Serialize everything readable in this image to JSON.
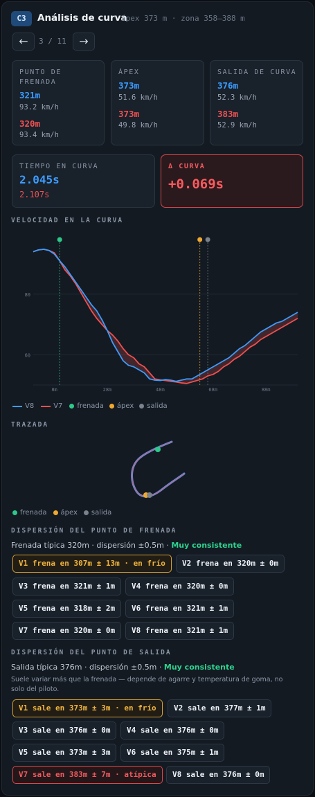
{
  "header": {
    "badge": "C3",
    "title": "Análisis de curva",
    "subtitle": "ápex 373 m · zona 358–388 m",
    "prev_label": "←",
    "next_label": "→",
    "counter": "3 / 11"
  },
  "cards": {
    "braking": {
      "label": "PUNTO DE FRENADA",
      "a_value": "321m",
      "a_speed": "93.2 km/h",
      "b_value": "320m",
      "b_speed": "93.4 km/h"
    },
    "apex": {
      "label": "ÁPEX",
      "a_value": "373m",
      "a_speed": "51.6 km/h",
      "b_value": "373m",
      "b_speed": "49.8 km/h"
    },
    "exit": {
      "label": "SALIDA DE CURVA",
      "a_value": "376m",
      "a_speed": "52.3 km/h",
      "b_value": "383m",
      "b_speed": "52.9 km/h"
    },
    "time": {
      "label": "TIEMPO EN CURVA",
      "a_value": "2.045s",
      "b_value": "2.107s"
    },
    "delta": {
      "label": "Δ CURVA",
      "value": "+0.069s"
    }
  },
  "speed_section": {
    "title": "VELOCIDAD EN LA CURVA"
  },
  "chart_data": {
    "type": "line",
    "x_ticks": [
      "8m",
      "28m",
      "48m",
      "68m",
      "88m"
    ],
    "y_ticks": [
      "80",
      "60"
    ],
    "xlim": [
      0,
      100
    ],
    "ylim": [
      50,
      98
    ],
    "markers": [
      {
        "name": "frenada",
        "x": 10,
        "color": "#2ec98a"
      },
      {
        "name": "ápex",
        "x": 63,
        "color": "#f0a830"
      },
      {
        "name": "salida",
        "x": 66,
        "color": "#7a828e"
      }
    ],
    "series": [
      {
        "name": "V8",
        "color": "#3b9cff",
        "x": [
          0,
          2,
          4,
          6,
          8,
          10,
          12,
          14,
          16,
          18,
          20,
          22,
          24,
          26,
          28,
          30,
          32,
          34,
          36,
          38,
          40,
          42,
          44,
          46,
          48,
          50,
          52,
          54,
          56,
          58,
          60,
          62,
          64,
          66,
          68,
          70,
          72,
          74,
          76,
          78,
          80,
          82,
          84,
          86,
          88,
          90,
          92,
          94,
          96,
          98,
          100
        ],
        "y": [
          94,
          94.6,
          94.8,
          94.4,
          93.2,
          91,
          89,
          86.5,
          84,
          81.5,
          79,
          76.5,
          74.5,
          71.5,
          68,
          64,
          61,
          58,
          56.5,
          56,
          55,
          54,
          52,
          51.6,
          51.5,
          51.8,
          51.6,
          51.2,
          51.6,
          52,
          52,
          53,
          54,
          55,
          56,
          57,
          58,
          59,
          60.5,
          62,
          63,
          64.5,
          66,
          67.5,
          68.5,
          69.5,
          70.5,
          71,
          72,
          73,
          74
        ]
      },
      {
        "name": "V7",
        "color": "#ef5050",
        "x": [
          0,
          2,
          4,
          6,
          8,
          10,
          12,
          14,
          16,
          18,
          20,
          22,
          24,
          26,
          28,
          30,
          32,
          34,
          36,
          38,
          40,
          42,
          44,
          46,
          48,
          50,
          52,
          54,
          56,
          58,
          60,
          62,
          64,
          66,
          68,
          70,
          72,
          74,
          76,
          78,
          80,
          82,
          84,
          86,
          88,
          90,
          92,
          94,
          96,
          98,
          100
        ],
        "y": [
          94,
          94.6,
          94.8,
          94.4,
          93.6,
          91,
          88,
          86,
          83.5,
          80.5,
          77.5,
          74.5,
          72,
          70,
          68,
          66.5,
          64.5,
          62,
          60,
          59,
          57,
          56,
          54,
          52,
          51.7,
          51.5,
          51.2,
          51,
          50.7,
          50.5,
          51,
          51.5,
          52,
          53,
          53.5,
          54.5,
          56,
          57,
          58.5,
          59.5,
          61,
          62.5,
          63.5,
          65,
          66,
          67,
          68,
          69,
          70,
          71,
          72
        ]
      }
    ]
  },
  "trace_section": {
    "title": "TRAZADA",
    "legend": [
      "frenada",
      "ápex",
      "salida"
    ]
  },
  "braking_dispersion": {
    "title": "DISPERSIÓN DEL PUNTO DE FRENADA",
    "summary_prefix": "Frenada típica 320m · dispersión ±0.5m · ",
    "summary_status": "Muy consistente",
    "chips": [
      {
        "text": "V1 frena en 307m ± 13m · en frío",
        "kind": "warn"
      },
      {
        "text": "V2 frena en 320m ± 0m",
        "kind": "normal"
      },
      {
        "text": "V3 frena en 321m ± 1m",
        "kind": "normal"
      },
      {
        "text": "V4 frena en 320m ± 0m",
        "kind": "normal"
      },
      {
        "text": "V5 frena en 318m ± 2m",
        "kind": "normal"
      },
      {
        "text": "V6 frena en 321m ± 1m",
        "kind": "normal"
      },
      {
        "text": "V7 frena en 320m ± 0m",
        "kind": "normal"
      },
      {
        "text": "V8 frena en 321m ± 1m",
        "kind": "normal"
      }
    ]
  },
  "exit_dispersion": {
    "title": "DISPERSIÓN DEL PUNTO DE SALIDA",
    "summary_prefix": "Salida típica 376m · dispersión ±0.5m · ",
    "summary_status": "Muy consistente",
    "note": "Suele variar más que la frenada — depende de agarre y temperatura de goma, no solo del piloto.",
    "chips": [
      {
        "text": "V1 sale en 373m ± 3m · en frío",
        "kind": "warn"
      },
      {
        "text": "V2 sale en 377m ± 1m",
        "kind": "normal"
      },
      {
        "text": "V3 sale en 376m ± 0m",
        "kind": "normal"
      },
      {
        "text": "V4 sale en 376m ± 0m",
        "kind": "normal"
      },
      {
        "text": "V5 sale en 373m ± 3m",
        "kind": "normal"
      },
      {
        "text": "V6 sale en 375m ± 1m",
        "kind": "normal"
      },
      {
        "text": "V7 sale en 383m ± 7m · atípica",
        "kind": "bad"
      },
      {
        "text": "V8 sale en 376m ± 0m",
        "kind": "normal"
      }
    ]
  }
}
